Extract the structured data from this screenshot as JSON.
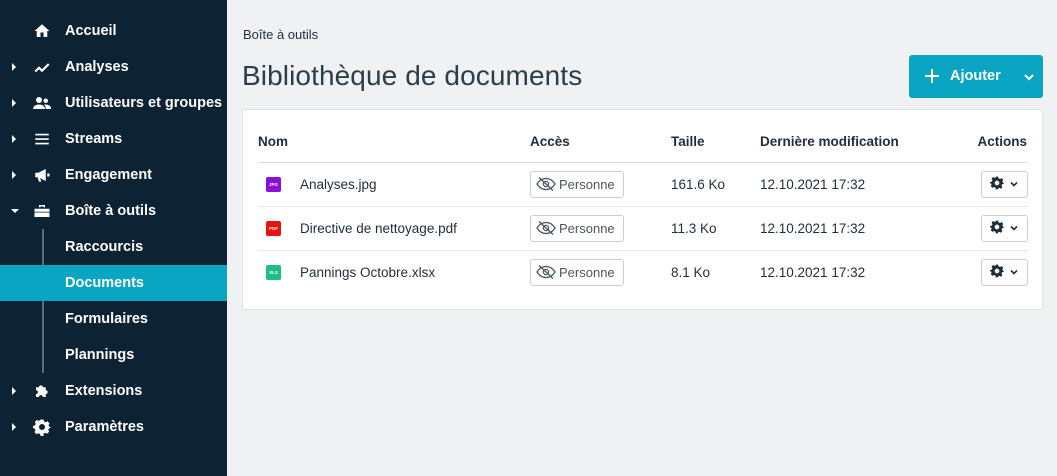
{
  "sidebar": {
    "items": [
      {
        "label": "Accueil",
        "icon": "home-icon",
        "caret": "none"
      },
      {
        "label": "Analyses",
        "icon": "chart-line-icon",
        "caret": "right"
      },
      {
        "label": "Utilisateurs et groupes",
        "icon": "users-icon",
        "caret": "right"
      },
      {
        "label": "Streams",
        "icon": "menu-lines-icon",
        "caret": "right"
      },
      {
        "label": "Engagement",
        "icon": "megaphone-icon",
        "caret": "right"
      },
      {
        "label": "Boîte à outils",
        "icon": "toolbox-icon",
        "caret": "down"
      },
      {
        "label": "Extensions",
        "icon": "puzzle-icon",
        "caret": "right"
      },
      {
        "label": "Paramètres",
        "icon": "gear-icon",
        "caret": "right"
      }
    ],
    "subitems": [
      {
        "label": "Raccourcis",
        "active": false
      },
      {
        "label": "Documents",
        "active": true
      },
      {
        "label": "Formulaires",
        "active": false
      },
      {
        "label": "Plannings",
        "active": false
      }
    ]
  },
  "breadcrumb": "Boîte à outils",
  "page_title": "Bibliothèque de documents",
  "add_button": {
    "label": "Ajouter"
  },
  "table": {
    "headers": {
      "name": "Nom",
      "access": "Accès",
      "size": "Taille",
      "modified": "Dernière modification",
      "actions": "Actions"
    },
    "rows": [
      {
        "type": "JPG",
        "type_color": "#8a0fd8",
        "name": "Analyses.jpg",
        "access": "Personne",
        "size": "161.6 Ko",
        "modified": "12.10.2021 17:32"
      },
      {
        "type": "PDF",
        "type_color": "#e8130f",
        "name": "Directive de nettoyage.pdf",
        "access": "Personne",
        "size": "11.3 Ko",
        "modified": "12.10.2021 17:32"
      },
      {
        "type": "XLS",
        "type_color": "#1fbf83",
        "name": "Pannings Octobre.xlsx",
        "access": "Personne",
        "size": "8.1 Ko",
        "modified": "12.10.2021 17:32"
      }
    ]
  },
  "colors": {
    "sidebar_bg": "#0d2233",
    "accent": "#0aa5c2",
    "page_bg": "#f0f1f2"
  }
}
